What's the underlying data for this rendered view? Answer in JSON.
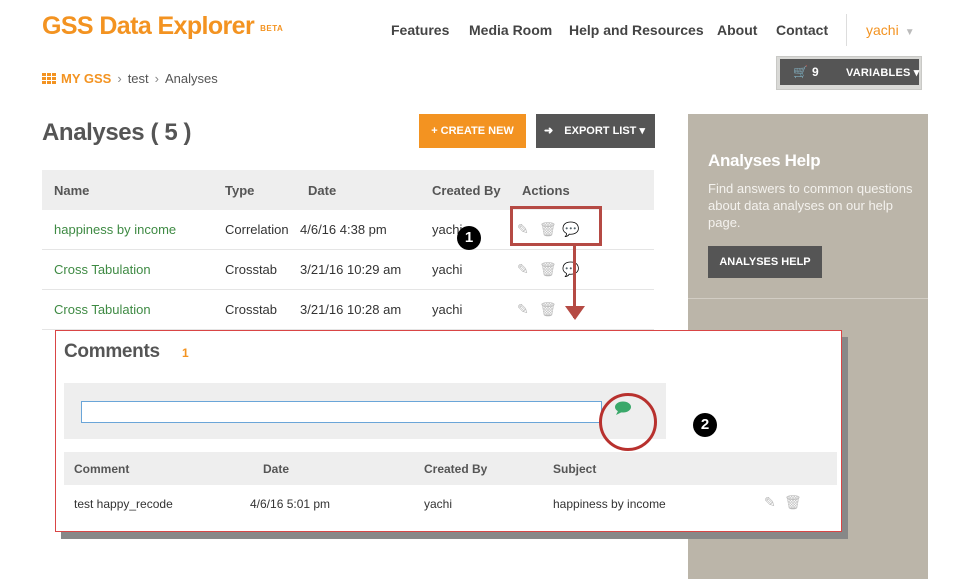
{
  "header": {
    "logo": "GSS Data Explorer",
    "logo_badge": "BETA",
    "nav": [
      "Features",
      "Media Room",
      "Help and Resources",
      "About",
      "Contact"
    ],
    "user": "yachi"
  },
  "breadcrumb": {
    "root": "MY GSS",
    "items": [
      "test",
      "Analyses"
    ]
  },
  "cart": {
    "count": "9",
    "variables_label": "VARIABLES"
  },
  "page": {
    "title": "Analyses ( 5 )",
    "create_label": "+ CREATE NEW",
    "export_label": "EXPORT LIST"
  },
  "table": {
    "headers": [
      "Name",
      "Type",
      "Date",
      "Created By",
      "Actions"
    ],
    "rows": [
      {
        "name": "happiness by income",
        "type": "Correlation",
        "date": "4/6/16 4:38 pm",
        "created_by": "yachi"
      },
      {
        "name": "Cross Tabulation",
        "type": "Crosstab",
        "date": "3/21/16 10:29 am",
        "created_by": "yachi"
      },
      {
        "name": "Cross Tabulation",
        "type": "Crosstab",
        "date": "3/21/16 10:28 am",
        "created_by": "yachi"
      }
    ]
  },
  "help": {
    "title": "Analyses Help",
    "text": "Find answers to common questions about data analyses on our help page.",
    "button": "ANALYSES HELP"
  },
  "comments": {
    "title": "Comments",
    "count": "1",
    "input_value": "",
    "headers": [
      "Comment",
      "Date",
      "Created By",
      "Subject"
    ],
    "rows": [
      {
        "comment": "test happy_recode",
        "date": "4/6/16 5:01 pm",
        "created_by": "yachi",
        "subject": "happiness by income"
      }
    ]
  },
  "annotations": {
    "step1": "1",
    "step2": "2"
  },
  "colors": {
    "accent": "#f39321",
    "link": "#3e8a43",
    "dark_button": "#555555",
    "help_panel": "#bbb5a9",
    "annotation": "#b54a44"
  }
}
